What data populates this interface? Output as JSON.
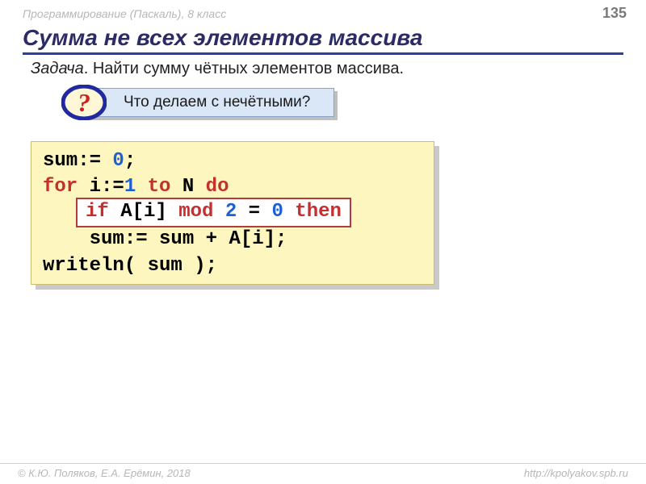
{
  "header": {
    "course": "Программирование (Паскаль), 8 класс",
    "page": "135"
  },
  "title": "Сумма не всех элементов массива",
  "task": {
    "label": "Задача",
    "text": ". Найти сумму чётных элементов массива."
  },
  "question": {
    "mark": "?",
    "text": "Что делаем с нечётными?"
  },
  "code": {
    "l1a": "sum:= ",
    "l1b": "0",
    "l1c": ";",
    "l2a": "for",
    "l2b": " i:=",
    "l2c": "1",
    "l2d": " ",
    "l2e": "to",
    "l2f": " N ",
    "l2g": "do",
    "l3": "",
    "l4": "    sum:= sum + A[i];",
    "l5": "writeln( sum );",
    "overlay_a": "if",
    "overlay_b": " A[i] ",
    "overlay_c": "mod",
    "overlay_d": " ",
    "overlay_e": "2",
    "overlay_f": " = ",
    "overlay_g": "0",
    "overlay_h": " ",
    "overlay_i": "then"
  },
  "footer": {
    "left": "© К.Ю. Поляков, Е.А. Ерёмин, 2018",
    "right": "http://kpolyakov.spb.ru"
  }
}
